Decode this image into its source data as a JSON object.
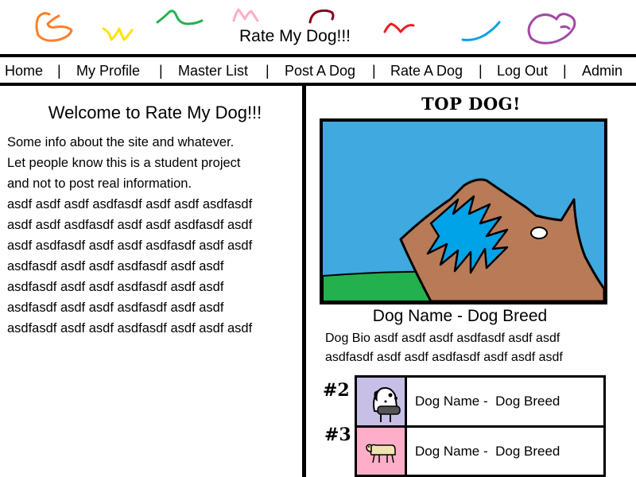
{
  "header": {
    "title": "Rate My Dog!!!"
  },
  "nav": {
    "items": [
      "Home",
      "My Profile",
      "Master List",
      "Post A Dog",
      "Rate A Dog",
      "Log Out",
      "Admin"
    ],
    "separator": "|"
  },
  "welcome": {
    "title": "Welcome to Rate My Dog!!!",
    "lines": [
      "Some info about the site and whatever.",
      "Let people know this is a student project",
      "and not to post real information.",
      "asdf asdf asdf asdfasdf asdf asdf asdfasdf",
      "asdf asdf asdfasdf asdf asdf asdfasdf asdf",
      "asdf asdfasdf asdf asdf asdfasdf asdf asdf",
      "asdfasdf asdf asdf asdfasdf asdf asdf",
      "asdfasdf asdf asdf asdfasdf asdf asdf",
      "asdfasdf asdf asdf asdfasdf asdf asdf",
      "asdfasdf asdf asdf asdfasdf asdf asdf asdf"
    ]
  },
  "top_dog": {
    "heading": "TOP DOG!",
    "title": "Dog Name - Dog Breed",
    "bio_lines": [
      "Dog Bio asdf asdf asdf asdfasdf asdf asdf",
      "asdfasdf asdf asdf asdfasdf asdf asdf asdf"
    ]
  },
  "runners_up": [
    {
      "rank": "#2",
      "text": "Dog Name -  Dog Breed",
      "thumb_color": "#c8bfe7"
    },
    {
      "rank": "#3",
      "text": "Dog Name -  Dog Breed",
      "thumb_color": "#ffaec9"
    }
  ],
  "colors": {
    "sky": "#3fa9e0",
    "grass": "#22b14c",
    "dog_brown": "#b97a57",
    "scribble_orange": "#ff7f27",
    "scribble_yellow": "#ffe400",
    "scribble_green": "#22b14c",
    "scribble_pink": "#ffaec9",
    "scribble_darkred": "#88001b",
    "scribble_red": "#ed1c24",
    "scribble_blue": "#00a2e8",
    "scribble_purple": "#a349a4"
  }
}
